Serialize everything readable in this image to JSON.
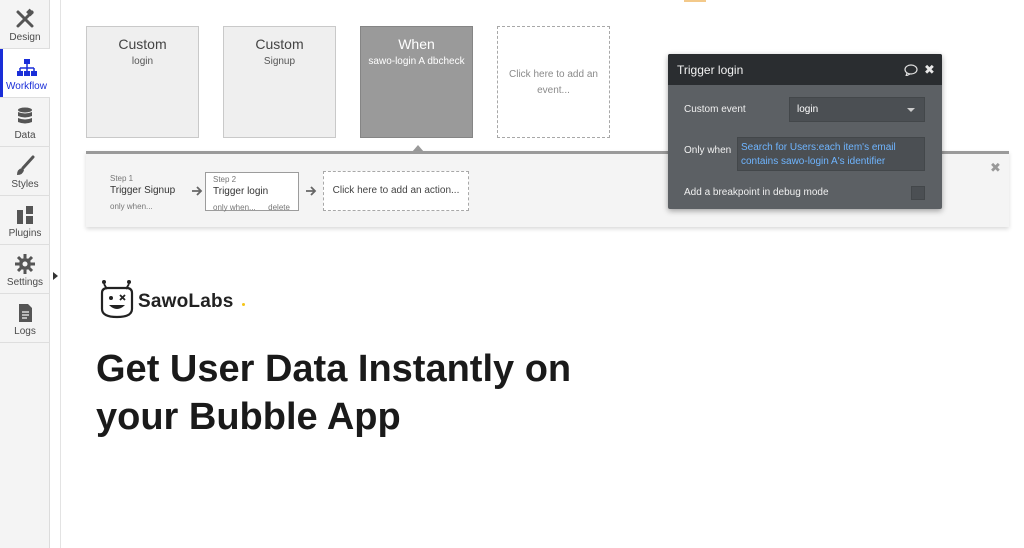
{
  "sidebar": {
    "items": [
      {
        "label": "Design",
        "icon": "design-tools-icon"
      },
      {
        "label": "Workflow",
        "icon": "workflow-icon"
      },
      {
        "label": "Data",
        "icon": "database-icon"
      },
      {
        "label": "Styles",
        "icon": "brush-icon"
      },
      {
        "label": "Plugins",
        "icon": "plugin-icon"
      },
      {
        "label": "Settings",
        "icon": "gear-icon"
      },
      {
        "label": "Logs",
        "icon": "document-icon"
      }
    ],
    "active": "Workflow",
    "active_color": "#1a2ed8"
  },
  "events": [
    {
      "title": "Custom",
      "subtitle": "login"
    },
    {
      "title": "Custom",
      "subtitle": "Signup"
    },
    {
      "title": "When",
      "subtitle": "sawo-login A dbcheck"
    },
    {
      "title": "",
      "subtitle": "Click here to add an event..."
    }
  ],
  "actions": {
    "step1": {
      "number": "Step 1",
      "title": "Trigger Signup",
      "condition": "only when..."
    },
    "step2": {
      "number": "Step 2",
      "title": "Trigger login",
      "condition": "only when...",
      "delete": "delete"
    },
    "add_action": "Click here to add an action..."
  },
  "property_editor": {
    "title": "Trigger login",
    "custom_event_label": "Custom event",
    "custom_event_value": "login",
    "only_when_label": "Only when",
    "only_when_expression_line1": "Search for Users:each item's email",
    "only_when_expression_line2": "contains sawo-login A's identifier",
    "breakpoint_label": "Add a breakpoint in debug mode",
    "expression_color": "#6fb5ff"
  },
  "page": {
    "brand": "SawoLabs",
    "headline_line1": "Get User Data Instantly on",
    "headline_line2": "your Bubble App"
  }
}
